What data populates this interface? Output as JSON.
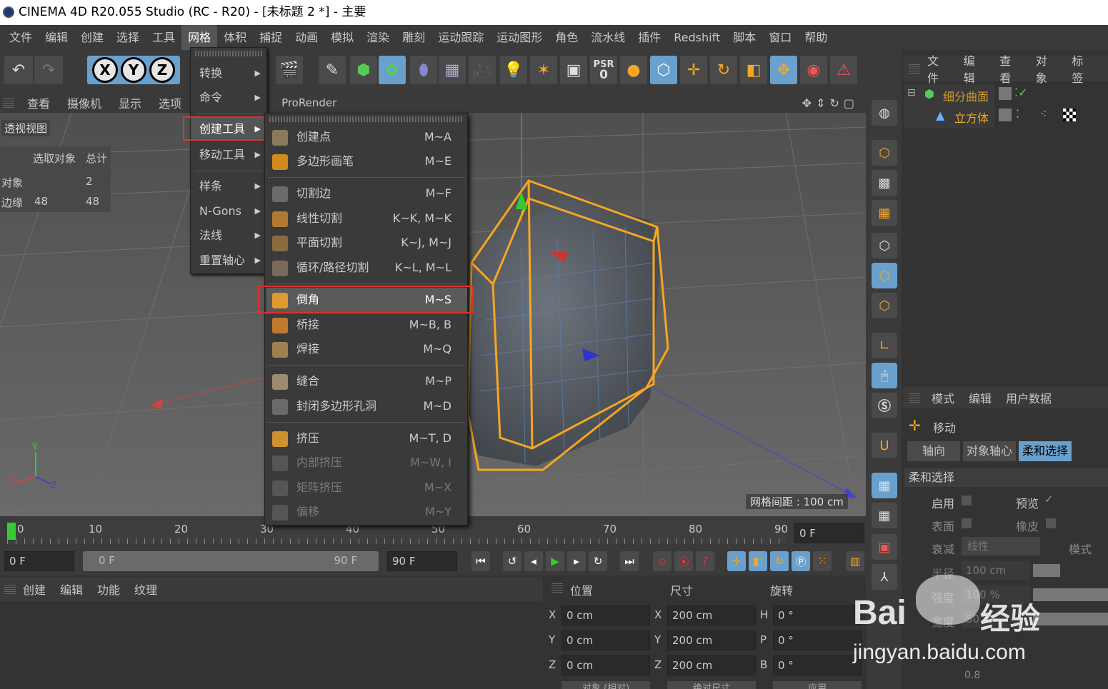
{
  "window": {
    "title": "CINEMA 4D R20.055 Studio (RC - R20) - [未标题 2 *] - 主要"
  },
  "menubar": [
    "文件",
    "编辑",
    "创建",
    "选择",
    "工具",
    "网格",
    "体积",
    "捕捉",
    "动画",
    "模拟",
    "渲染",
    "雕刻",
    "运动跟踪",
    "运动图形",
    "角色",
    "流水线",
    "插件",
    "Redshift",
    "脚本",
    "窗口",
    "帮助"
  ],
  "toolbar": {
    "psr_label": "PSR",
    "psr_value": "0"
  },
  "viewport_menu": [
    "查看",
    "摄像机",
    "显示",
    "选项"
  ],
  "viewport": {
    "label": "透视视图",
    "render_label": "ProRender",
    "grid_spacing": "网格间距 : 100 cm",
    "stats": {
      "header_sel": "选取对象",
      "header_total": "总计",
      "rows": [
        {
          "name": "对象",
          "sel": "",
          "total": "2"
        },
        {
          "name": "边缘",
          "sel": "48",
          "total": "48"
        }
      ]
    },
    "axis": {
      "x": "X",
      "y": "Y",
      "z": "Z"
    }
  },
  "menu_level1": [
    {
      "label": "转换"
    },
    {
      "label": "命令"
    },
    {
      "label": "创建工具"
    },
    {
      "label": "移动工具"
    },
    {
      "label": "样条"
    },
    {
      "label": "N-Gons"
    },
    {
      "label": "法线"
    },
    {
      "label": "重置轴心"
    }
  ],
  "menu_level2": [
    {
      "label": "创建点",
      "shortcut": "M~A",
      "disabled": false
    },
    {
      "label": "多边形画笔",
      "shortcut": "M~E",
      "disabled": false
    },
    {
      "label": "切割边",
      "shortcut": "M~F",
      "disabled": false
    },
    {
      "label": "线性切割",
      "shortcut": "K~K, M~K",
      "disabled": false
    },
    {
      "label": "平面切割",
      "shortcut": "K~J, M~J",
      "disabled": false
    },
    {
      "label": "循环/路径切割",
      "shortcut": "K~L, M~L",
      "disabled": false
    },
    {
      "label": "倒角",
      "shortcut": "M~S",
      "disabled": false
    },
    {
      "label": "桥接",
      "shortcut": "M~B, B",
      "disabled": false
    },
    {
      "label": "焊接",
      "shortcut": "M~Q",
      "disabled": false
    },
    {
      "label": "缝合",
      "shortcut": "M~P",
      "disabled": false
    },
    {
      "label": "封闭多边形孔洞",
      "shortcut": "M~D",
      "disabled": false
    },
    {
      "label": "挤压",
      "shortcut": "M~T, D",
      "disabled": false
    },
    {
      "label": "内部挤压",
      "shortcut": "M~W, I",
      "disabled": true
    },
    {
      "label": "矩阵挤压",
      "shortcut": "M~X",
      "disabled": true
    },
    {
      "label": "偏移",
      "shortcut": "M~Y",
      "disabled": true
    }
  ],
  "timeline": {
    "ticks": [
      "0",
      "10",
      "20",
      "30",
      "40",
      "50",
      "60",
      "70",
      "80",
      "90"
    ],
    "current": "0 F",
    "start": "0 F",
    "range_start": "0 F",
    "range_end": "90 F",
    "end": "90 F"
  },
  "material_manager": [
    "创建",
    "编辑",
    "功能",
    "纹理"
  ],
  "coordinates": {
    "headers": [
      "位置",
      "尺寸",
      "旋转"
    ],
    "rows": [
      {
        "axis": "X",
        "pos": "0 cm",
        "size_axis": "X",
        "size": "200 cm",
        "rot_axis": "H",
        "rot": "0 °"
      },
      {
        "axis": "Y",
        "pos": "0 cm",
        "size_axis": "Y",
        "size": "200 cm",
        "rot_axis": "P",
        "rot": "0 °"
      },
      {
        "axis": "Z",
        "pos": "0 cm",
        "size_axis": "Z",
        "size": "200 cm",
        "rot_axis": "B",
        "rot": "0 °"
      }
    ],
    "buttons": [
      "对象 (相对)",
      "绝对尺寸",
      "应用"
    ]
  },
  "object_manager": {
    "menu": [
      "文件",
      "编辑",
      "查看",
      "对象",
      "标签"
    ],
    "objects": [
      {
        "name": "细分曲面"
      },
      {
        "name": "立方体"
      }
    ]
  },
  "attributes": {
    "menu": [
      "模式",
      "编辑",
      "用户数据"
    ],
    "tool": "移动",
    "tabs": [
      "轴向",
      "对象轴心",
      "柔和选择"
    ],
    "section": "柔和选择",
    "fields": {
      "enable": "启用",
      "preview": "预览",
      "surface": "表面",
      "rubber": "橡皮",
      "falloff": "衰减",
      "falloff_value": "线性",
      "mode": "模式",
      "radius": "半径",
      "radius_value": "100 cm",
      "strength": "强度",
      "strength_value": "100 %",
      "width": "宽度",
      "width_value": "50 %",
      "bottom_value": "0.8"
    }
  },
  "watermark": {
    "brand": "Bai",
    "brand_cn": "经验",
    "url": "jingyan.baidu.com"
  },
  "colors": {
    "accent": "#f5a623",
    "selection": "#6aa0cc",
    "highlight_box": "#e03030"
  }
}
